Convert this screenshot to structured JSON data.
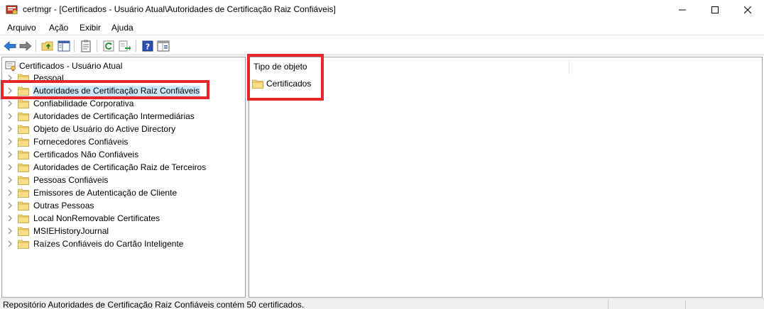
{
  "window": {
    "title": "certmgr - [Certificados - Usuário Atual\\Autoridades de Certificação Raiz Confiáveis]"
  },
  "menu": {
    "items": [
      {
        "label": "Arquivo"
      },
      {
        "label": "Ação"
      },
      {
        "label": "Exibir"
      },
      {
        "label": "Ajuda"
      }
    ]
  },
  "toolbar": {
    "buttons": [
      "back-arrow-icon",
      "forward-arrow-icon",
      "up-folder-icon",
      "show-hide-tree-icon",
      "properties-icon",
      "refresh-icon",
      "export-list-icon",
      "help-icon",
      "details-view-icon"
    ]
  },
  "tree": {
    "root": "Certificados - Usuário Atual",
    "items": [
      {
        "label": "Pessoal"
      },
      {
        "label": "Autoridades de Certificação Raiz Confiáveis",
        "selected": true
      },
      {
        "label": "Confiabilidade Corporativa"
      },
      {
        "label": "Autoridades de Certificação Intermediárias"
      },
      {
        "label": "Objeto de Usuário do Active Directory"
      },
      {
        "label": "Fornecedores Confiáveis"
      },
      {
        "label": "Certificados Não Confiáveis"
      },
      {
        "label": "Autoridades de Certificação Raiz de Terceiros"
      },
      {
        "label": "Pessoas Confiáveis"
      },
      {
        "label": "Emissores de Autenticação de Cliente"
      },
      {
        "label": "Outras Pessoas"
      },
      {
        "label": "Local NonRemovable Certificates"
      },
      {
        "label": "MSIEHistoryJournal"
      },
      {
        "label": "Raízes Confiáveis do Cartão Inteligente"
      }
    ]
  },
  "list": {
    "column_header": "Tipo de objeto",
    "items": [
      {
        "label": "Certificados"
      }
    ]
  },
  "status": {
    "text": "Repositório Autoridades de Certificação Raiz Confiáveis contém 50 certificados."
  },
  "colors": {
    "highlight": "#e5262a",
    "selection": "#cce8ff",
    "folder": "#f2d373"
  }
}
